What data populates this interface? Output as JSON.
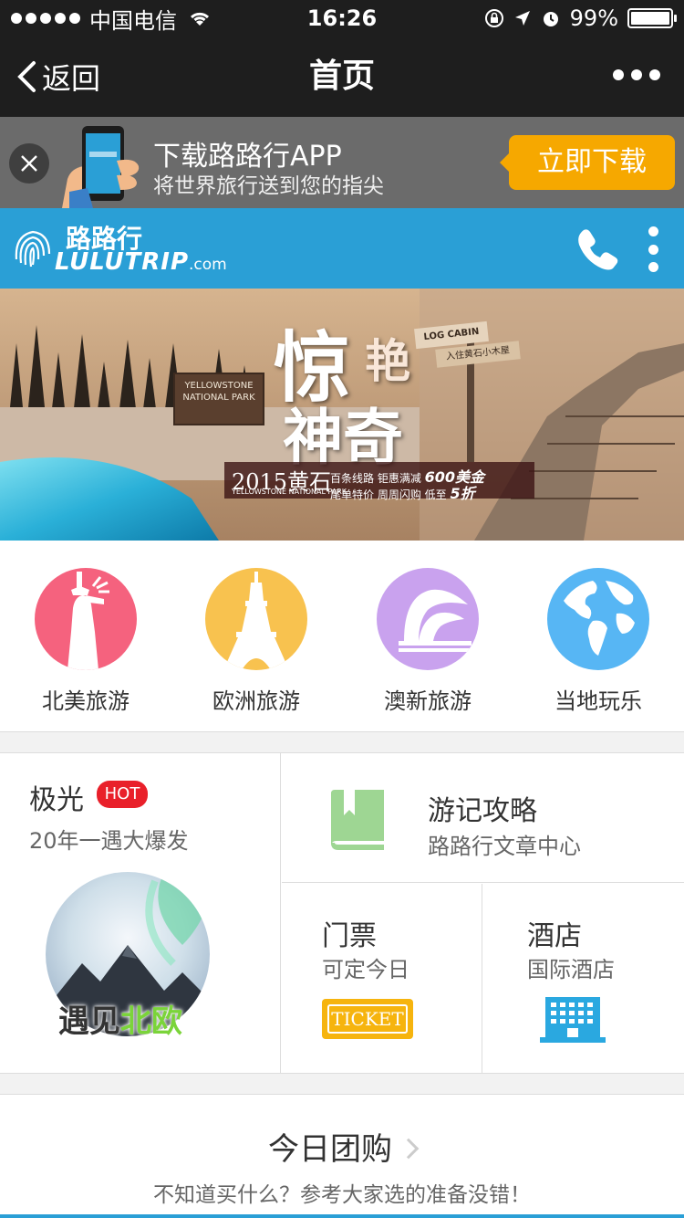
{
  "status_bar": {
    "carrier": "中国电信",
    "time": "16:26",
    "battery": "99%",
    "battery_level": 0.99
  },
  "nav": {
    "back_label": "返回",
    "title": "首页"
  },
  "download_banner": {
    "title": "下载路路行APP",
    "subtitle": "将世界旅行送到您的指尖",
    "button_label": "立即下载"
  },
  "brand": {
    "name_cn": "路路行",
    "name_en": "LULUTRIP",
    "domain": ".com",
    "color": "#2a9fd6"
  },
  "hero": {
    "headline_1": "惊",
    "headline_2": "艳",
    "headline_3": "神奇",
    "year_label": "2015黄石",
    "park_label": "YELLOWSTONE NATIONAL PARK",
    "deal_line_1": "百条线路  钜惠满减",
    "deal_amount": "600美金",
    "deal_line_2": "尾单特价  周周闪购  低至",
    "deal_discount": "5折",
    "sign_text": "YELLOWSTONE NATIONAL PARK",
    "cabin_sign": "LOG CABIN",
    "cabin_sign_2": "入住黄石小木屋"
  },
  "categories": [
    {
      "label": "北美旅游",
      "icon": "statue-of-liberty-icon",
      "color": "#f5627e"
    },
    {
      "label": "欧洲旅游",
      "icon": "eiffel-tower-icon",
      "color": "#f8c24f"
    },
    {
      "label": "澳新旅游",
      "icon": "sydney-opera-house-icon",
      "color": "#c9a2ee"
    },
    {
      "label": "当地玩乐",
      "icon": "globe-icon",
      "color": "#57b6f4"
    }
  ],
  "features": {
    "aurora": {
      "title": "极光",
      "badge": "HOT",
      "subtitle": "20年一遇大爆发",
      "caption_a": "遇见",
      "caption_b": "北欧"
    },
    "guide": {
      "title": "游记攻略",
      "subtitle": "路路行文章中心"
    },
    "ticket": {
      "title": "门票",
      "subtitle": "可定今日",
      "ticket_text": "TICKET"
    },
    "hotel": {
      "title": "酒店",
      "subtitle": "国际酒店"
    }
  },
  "group_buy": {
    "title": "今日团购",
    "subtitle": "不知道买什么？参考大家选的准备没错！"
  }
}
